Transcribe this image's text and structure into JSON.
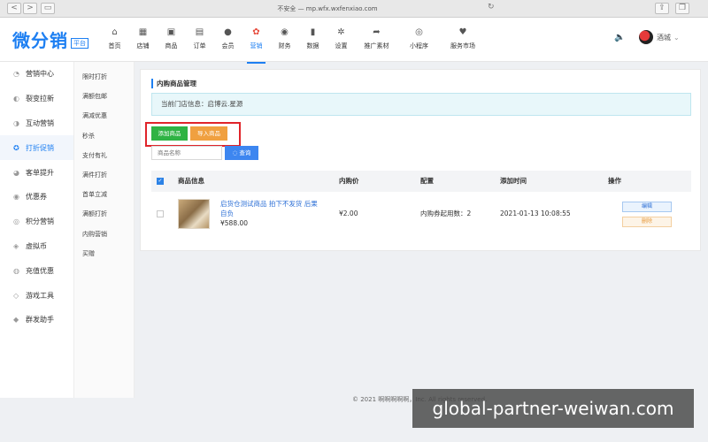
{
  "browser": {
    "url": "不安全 — mp.wfx.wxfenxiao.com",
    "back": "<",
    "forward": ">"
  },
  "brand": {
    "logo_text": "微分销",
    "logo_sub": "平台",
    "accent": "#1d7ff2"
  },
  "topnav": [
    {
      "label": "首页",
      "icon": "home-icon",
      "glyph": "⌂"
    },
    {
      "label": "店铺",
      "icon": "store-icon",
      "glyph": "▦"
    },
    {
      "label": "商品",
      "icon": "goods-icon",
      "glyph": "▣"
    },
    {
      "label": "订单",
      "icon": "order-icon",
      "glyph": "▤"
    },
    {
      "label": "会员",
      "icon": "member-icon",
      "glyph": "●"
    },
    {
      "label": "营销",
      "icon": "marketing-icon",
      "glyph": "✿",
      "active": true
    },
    {
      "label": "财务",
      "icon": "finance-icon",
      "glyph": "◉"
    },
    {
      "label": "数据",
      "icon": "data-icon",
      "glyph": "▮"
    },
    {
      "label": "设置",
      "icon": "settings-icon",
      "glyph": "✲"
    },
    {
      "label": "推广素材",
      "icon": "share-icon",
      "glyph": "➦"
    },
    {
      "label": "小程序",
      "icon": "miniapp-icon",
      "glyph": "◎"
    },
    {
      "label": "服务市场",
      "icon": "market-icon",
      "glyph": "♥"
    }
  ],
  "user": {
    "name": "酒城"
  },
  "sidebar": [
    {
      "label": "营销中心",
      "icon": "center-icon"
    },
    {
      "label": "裂变拉新",
      "icon": "fission-icon"
    },
    {
      "label": "互动营销",
      "icon": "interact-icon"
    },
    {
      "label": "打折促销",
      "icon": "discount-icon",
      "active": true
    },
    {
      "label": "客单提升",
      "icon": "upsell-icon"
    },
    {
      "label": "优惠券",
      "icon": "coupon-icon"
    },
    {
      "label": "积分营销",
      "icon": "points-icon"
    },
    {
      "label": "虚拟币",
      "icon": "coin-icon"
    },
    {
      "label": "充值优惠",
      "icon": "recharge-icon"
    },
    {
      "label": "游戏工具",
      "icon": "game-icon"
    },
    {
      "label": "群发助手",
      "icon": "broadcast-icon"
    }
  ],
  "subnav": [
    "限时打折",
    "满额包邮",
    "满减优惠",
    "秒杀",
    "支付有礼",
    "满件打折",
    "首单立减",
    "满额打折",
    "内购营销",
    "买赠"
  ],
  "page": {
    "title": "内购商品管理",
    "store_info": "当前门店信息：启博云.星源",
    "add_label": "添加商品",
    "import_label": "导入商品",
    "search_placeholder": "商品名称",
    "search_label": "◌ 查询"
  },
  "table": {
    "headers": [
      "商品信息",
      "内购价",
      "配置",
      "添加时间",
      "操作"
    ],
    "rows": [
      {
        "name": "启货仓测试商品 拍下不发货 后果自负",
        "price": "¥588.00",
        "inner_price": "¥2.00",
        "config": "内购券起用数：2",
        "added": "2021-01-13 10:08:55",
        "edit": "编辑",
        "delete": "删除"
      }
    ]
  },
  "footer": "© 2021 啊啊啊啊啊，Inc. All rights reserved.",
  "watermark": "global-partner-weiwan.com"
}
